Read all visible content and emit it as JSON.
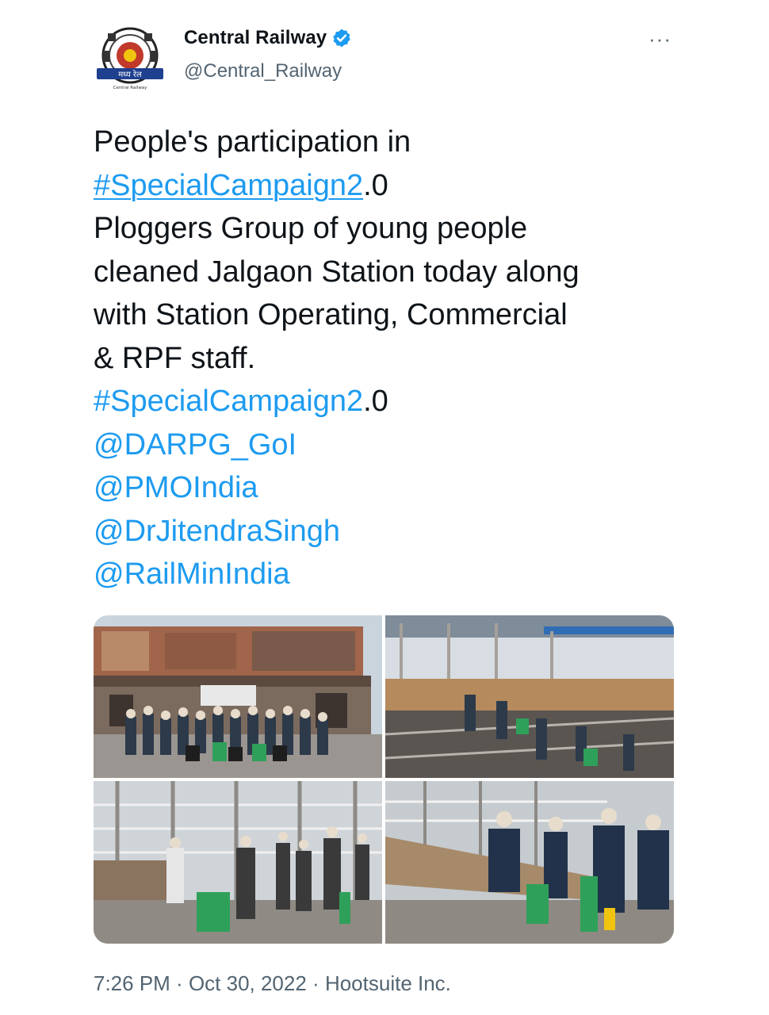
{
  "header": {
    "display_name": "Central Railway",
    "handle": "@Central_Railway",
    "verified_icon": "verified-badge-icon",
    "more_icon": "more-options-icon",
    "more_label": "···",
    "avatar_text": "मध्य रेल",
    "avatar_subtext": "Central Railway"
  },
  "tweet": {
    "line1": "People's participation in",
    "hashtag1": "#SpecialCampaign2",
    "hashtag1_suffix": ".0",
    "line3": "Ploggers Group of young people",
    "line4": "cleaned Jalgaon Station today along",
    "line5": "with Station Operating, Commercial",
    "line6": "& RPF staff.",
    "hashtag2": "#SpecialCampaign2",
    "hashtag2_suffix": ".0",
    "mention1": "@DARPG_GoI",
    "mention2": "@PMOIndia",
    "mention3": "@DrJitendraSingh",
    "mention4": "@RailMinIndia"
  },
  "media": {
    "count": 4
  },
  "footer": {
    "time": "7:26 PM",
    "separator": " · ",
    "date": "Oct 30, 2022",
    "source": "Hootsuite Inc."
  },
  "colors": {
    "link": "#1d9bf0",
    "text": "#0f1419",
    "secondary": "#536471"
  }
}
